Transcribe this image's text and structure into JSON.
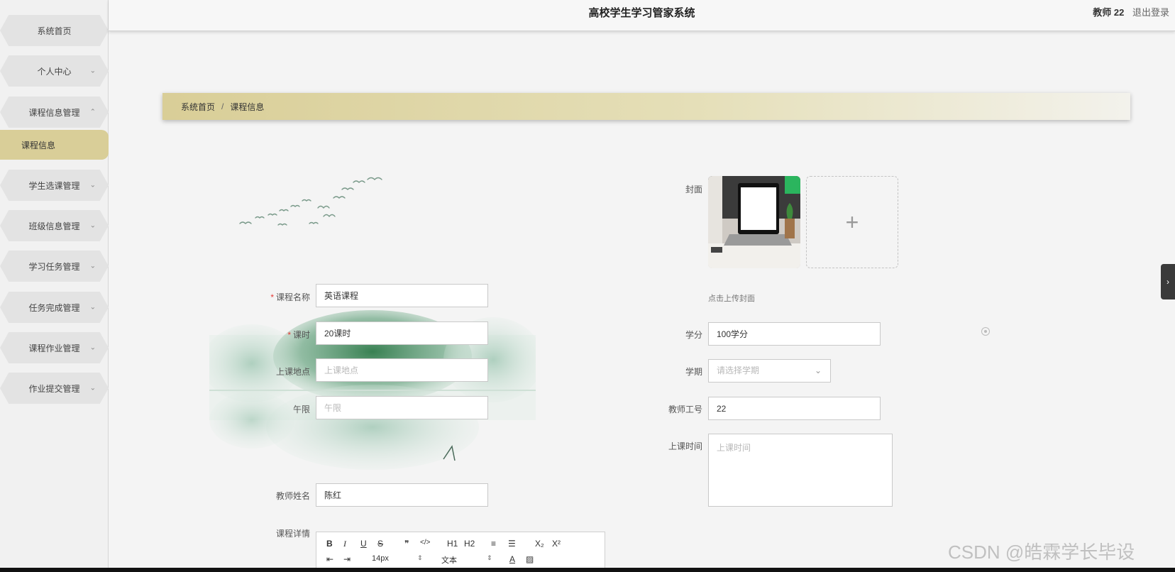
{
  "header": {
    "title": "高校学生学习管家系统",
    "user": "教师 22",
    "logout": "退出登录"
  },
  "sidebar": {
    "items": [
      {
        "label": "系统首页"
      },
      {
        "label": "个人中心"
      },
      {
        "label": "课程信息管理"
      },
      {
        "label": "学生选课管理"
      },
      {
        "label": "班级信息管理"
      },
      {
        "label": "学习任务管理"
      },
      {
        "label": "任务完成管理"
      },
      {
        "label": "课程作业管理"
      },
      {
        "label": "作业提交管理"
      }
    ],
    "active_sub": "课程信息"
  },
  "breadcrumb": {
    "home": "系统首页",
    "sep": "/",
    "current": "课程信息"
  },
  "form": {
    "course_name": {
      "label": "课程名称",
      "value": "英语课程",
      "required": true
    },
    "hours": {
      "label": "课时",
      "value": "20课时",
      "required": true
    },
    "location": {
      "label": "上课地点",
      "placeholder": "上课地点"
    },
    "limit": {
      "label": "午限",
      "placeholder": "午限"
    },
    "teacher_name": {
      "label": "教师姓名",
      "value": "陈红"
    },
    "detail": {
      "label": "课程详情"
    },
    "cover": {
      "label": "封面",
      "tip": "点击上传封面",
      "add": "+"
    },
    "credit": {
      "label": "学分",
      "value": "100学分"
    },
    "term": {
      "label": "学期",
      "placeholder": "请选择学期"
    },
    "teacher_no": {
      "label": "教师工号",
      "value": "22"
    },
    "class_time": {
      "label": "上课时间",
      "placeholder": "上课时间"
    }
  },
  "editor": {
    "row1": [
      "B",
      "I",
      "U",
      "S",
      "❞",
      "</>",
      "H1",
      "H2",
      "≡",
      "☰",
      "X₂",
      "X²"
    ],
    "font_size": "14px",
    "header_style": "文本"
  },
  "watermark": "CSDN @皓霖学长毕设",
  "colors": {
    "accent": "#d9ce98",
    "required": "#e53935"
  }
}
